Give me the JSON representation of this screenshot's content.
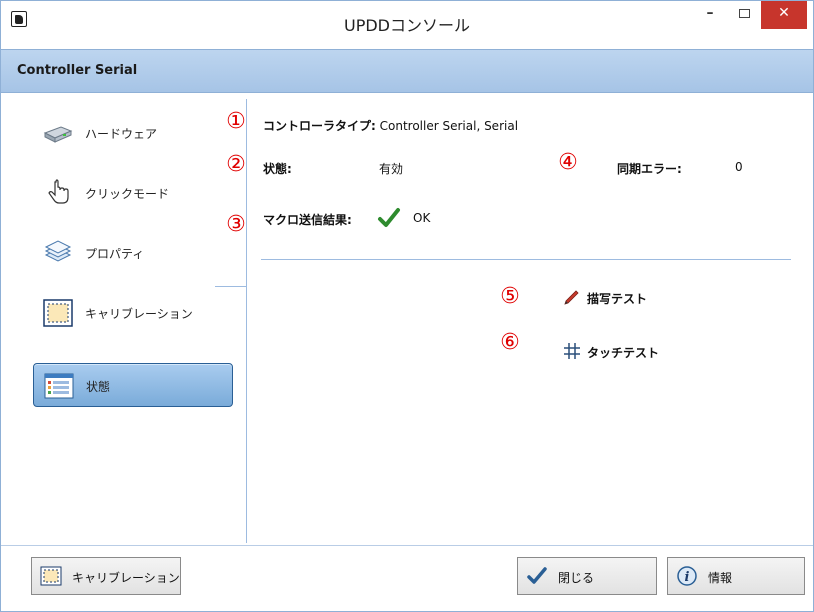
{
  "window": {
    "title": "UPDDコンソール",
    "controls": {
      "minimize": "–",
      "maximize": "□",
      "close": "✕"
    }
  },
  "header": {
    "title": "Controller Serial"
  },
  "sidebar": {
    "items": [
      {
        "label": "ハードウェア",
        "icon": "hardware-icon"
      },
      {
        "label": "クリックモード",
        "icon": "hand-pointer-icon"
      },
      {
        "label": "プロパティ",
        "icon": "layers-icon"
      },
      {
        "label": "キャリブレーション",
        "icon": "calibration-icon"
      },
      {
        "label": "状態",
        "icon": "status-list-icon",
        "active": true
      }
    ]
  },
  "main": {
    "markers": [
      "①",
      "②",
      "③",
      "④",
      "⑤",
      "⑥"
    ],
    "controller_type_label": "コントローラタイプ:",
    "controller_type_value": "Controller Serial, Serial",
    "status_label": "状態:",
    "status_value": "有効",
    "sync_error_label": "同期エラー:",
    "sync_error_value": "0",
    "macro_label": "マクロ送信結果:",
    "macro_value": "OK",
    "draw_test_label": "描写テスト",
    "touch_test_label": "タッチテスト"
  },
  "footer": {
    "calibration_button": "キャリブレーション",
    "close_button": "閉じる",
    "info_button": "情報"
  },
  "colors": {
    "accent_red": "#e00000",
    "header_bg": "#a6c4e6",
    "active_item": "#7aabd9",
    "close_button": "#c7352c",
    "check_green": "#2e8b2e"
  }
}
